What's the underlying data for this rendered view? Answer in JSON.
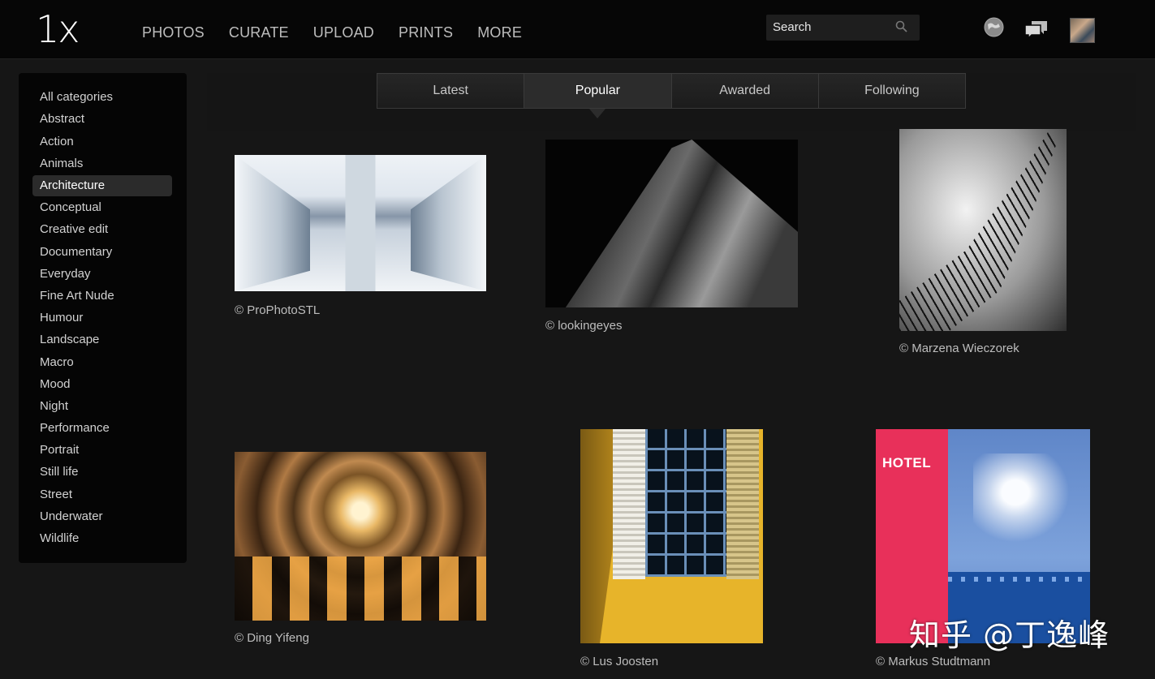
{
  "header": {
    "logo": "1x",
    "nav": [
      "PHOTOS",
      "CURATE",
      "UPLOAD",
      "PRINTS",
      "MORE"
    ],
    "search_placeholder": "Search"
  },
  "sidebar": {
    "categories": [
      "All categories",
      "Abstract",
      "Action",
      "Animals",
      "Architecture",
      "Conceptual",
      "Creative edit",
      "Documentary",
      "Everyday",
      "Fine Art Nude",
      "Humour",
      "Landscape",
      "Macro",
      "Mood",
      "Night",
      "Performance",
      "Portrait",
      "Still life",
      "Street",
      "Underwater",
      "Wildlife"
    ],
    "active": "Architecture"
  },
  "tabs": {
    "items": [
      "Latest",
      "Popular",
      "Awarded",
      "Following"
    ],
    "active": "Popular"
  },
  "photos": [
    {
      "credit": "© ProPhotoSTL"
    },
    {
      "credit": "© lookingeyes"
    },
    {
      "credit": "© Marzena Wieczorek"
    },
    {
      "credit": "© Ding Yifeng"
    },
    {
      "credit": "© Lus Joosten"
    },
    {
      "credit": "© Markus Studtmann",
      "sign_text": "HOTEL"
    }
  ],
  "watermark": "知乎 @丁逸峰",
  "colors": {
    "background": "#161616",
    "header": "#060606",
    "sidebar": "#050505",
    "active_item": "#2b2b2b"
  },
  "icons": [
    "search-icon",
    "globe-icon",
    "chat-bubbles-icon"
  ]
}
